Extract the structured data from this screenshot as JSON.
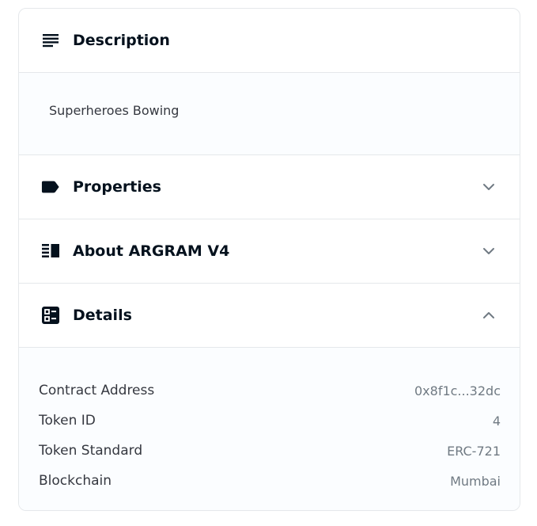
{
  "description": {
    "icon": "subject-icon",
    "title": "Description",
    "text": "Superheroes Bowing"
  },
  "properties": {
    "icon": "label-icon",
    "title": "Properties",
    "expanded": false
  },
  "about": {
    "icon": "vertical-split-icon",
    "title": "About ARGRAM V4",
    "expanded": false
  },
  "details": {
    "icon": "dashboard-icon",
    "title": "Details",
    "expanded": true,
    "rows": [
      {
        "label": "Contract Address",
        "value": "0x8f1c...32dc"
      },
      {
        "label": "Token ID",
        "value": "4"
      },
      {
        "label": "Token Standard",
        "value": "ERC-721"
      },
      {
        "label": "Blockchain",
        "value": "Mumbai"
      }
    ]
  },
  "colors": {
    "text_primary": "#04111d",
    "text_secondary": "#707a83",
    "border": "#e5e8eb",
    "panel_bg": "#fbfdff"
  }
}
